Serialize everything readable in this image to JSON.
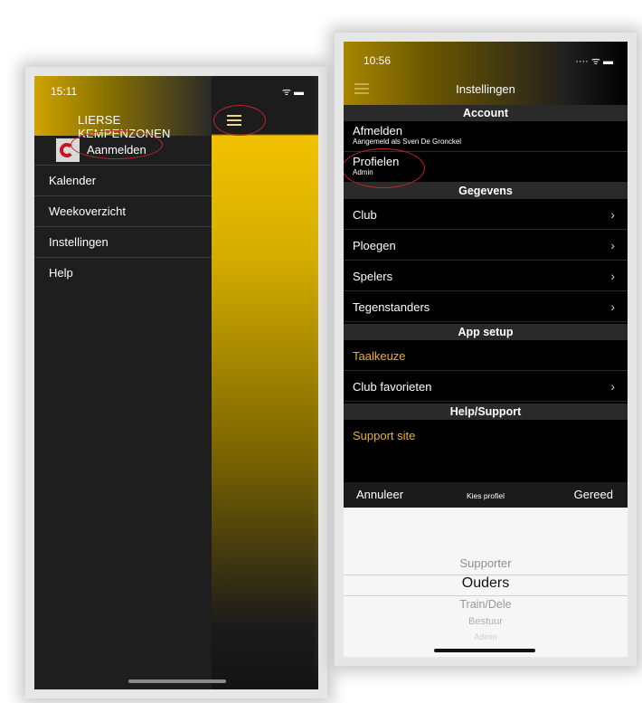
{
  "left_screen": {
    "status": {
      "time": "15:11",
      "icons": "ᯤ ▬"
    },
    "header": {
      "title": "LIERSE KEMPENZONEN",
      "menu_icon": "hamburger-icon"
    },
    "login": {
      "label": "Aanmelden",
      "avatar": "club-logo-avatar"
    },
    "menu": [
      {
        "label": "Kalender"
      },
      {
        "label": "Weekoverzicht"
      },
      {
        "label": "Instellingen"
      },
      {
        "label": "Help"
      }
    ]
  },
  "right_screen": {
    "status": {
      "time": "10:56",
      "icons": "····  ᯤ ▬"
    },
    "header": {
      "title": "Instellingen",
      "menu_icon": "hamburger-icon"
    },
    "sections": {
      "account": {
        "title": "Account",
        "afmelden": {
          "label": "Afmelden",
          "sub": "Aangemeld als Sven De Gronckel"
        },
        "profielen": {
          "label": "Profielen",
          "sub": "Admin"
        }
      },
      "gegevens": {
        "title": "Gegevens",
        "items": [
          {
            "label": "Club"
          },
          {
            "label": "Ploegen"
          },
          {
            "label": "Spelers"
          },
          {
            "label": "Tegenstanders"
          }
        ]
      },
      "app_setup": {
        "title": "App setup",
        "taalkeuze": {
          "label": "Taalkeuze"
        },
        "favorieten": {
          "label": "Club favorieten"
        }
      },
      "help_support": {
        "title": "Help/Support",
        "support": {
          "label": "Support site"
        }
      }
    },
    "chevron": "›",
    "picker": {
      "cancel": "Annuleer",
      "title": "Kies profiel",
      "done": "Gereed",
      "options": [
        "Supporter",
        "Ouders",
        "Train/Dele",
        "Bestuur",
        "Admin"
      ],
      "selected": "Ouders"
    }
  },
  "colors": {
    "gold": "#f2c200",
    "accent_text": "#e9b41a",
    "annotation_red": "#c0262c",
    "dark_bg": "#1e1e1e"
  }
}
